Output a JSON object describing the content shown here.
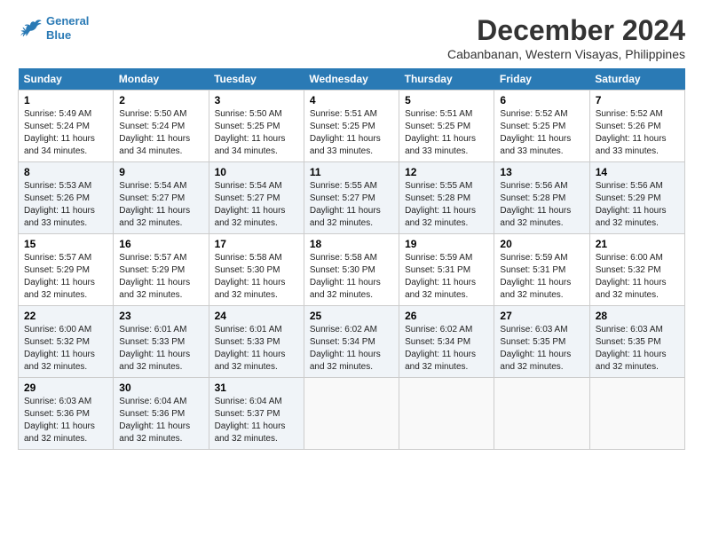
{
  "logo": {
    "line1": "General",
    "line2": "Blue"
  },
  "title": "December 2024",
  "location": "Cabanbanan, Western Visayas, Philippines",
  "days_of_week": [
    "Sunday",
    "Monday",
    "Tuesday",
    "Wednesday",
    "Thursday",
    "Friday",
    "Saturday"
  ],
  "weeks": [
    [
      {
        "day": 1,
        "sunrise": "5:49 AM",
        "sunset": "5:24 PM",
        "daylight": "11 hours and 34 minutes."
      },
      {
        "day": 2,
        "sunrise": "5:50 AM",
        "sunset": "5:24 PM",
        "daylight": "11 hours and 34 minutes."
      },
      {
        "day": 3,
        "sunrise": "5:50 AM",
        "sunset": "5:25 PM",
        "daylight": "11 hours and 34 minutes."
      },
      {
        "day": 4,
        "sunrise": "5:51 AM",
        "sunset": "5:25 PM",
        "daylight": "11 hours and 33 minutes."
      },
      {
        "day": 5,
        "sunrise": "5:51 AM",
        "sunset": "5:25 PM",
        "daylight": "11 hours and 33 minutes."
      },
      {
        "day": 6,
        "sunrise": "5:52 AM",
        "sunset": "5:25 PM",
        "daylight": "11 hours and 33 minutes."
      },
      {
        "day": 7,
        "sunrise": "5:52 AM",
        "sunset": "5:26 PM",
        "daylight": "11 hours and 33 minutes."
      }
    ],
    [
      {
        "day": 8,
        "sunrise": "5:53 AM",
        "sunset": "5:26 PM",
        "daylight": "11 hours and 33 minutes."
      },
      {
        "day": 9,
        "sunrise": "5:54 AM",
        "sunset": "5:27 PM",
        "daylight": "11 hours and 32 minutes."
      },
      {
        "day": 10,
        "sunrise": "5:54 AM",
        "sunset": "5:27 PM",
        "daylight": "11 hours and 32 minutes."
      },
      {
        "day": 11,
        "sunrise": "5:55 AM",
        "sunset": "5:27 PM",
        "daylight": "11 hours and 32 minutes."
      },
      {
        "day": 12,
        "sunrise": "5:55 AM",
        "sunset": "5:28 PM",
        "daylight": "11 hours and 32 minutes."
      },
      {
        "day": 13,
        "sunrise": "5:56 AM",
        "sunset": "5:28 PM",
        "daylight": "11 hours and 32 minutes."
      },
      {
        "day": 14,
        "sunrise": "5:56 AM",
        "sunset": "5:29 PM",
        "daylight": "11 hours and 32 minutes."
      }
    ],
    [
      {
        "day": 15,
        "sunrise": "5:57 AM",
        "sunset": "5:29 PM",
        "daylight": "11 hours and 32 minutes."
      },
      {
        "day": 16,
        "sunrise": "5:57 AM",
        "sunset": "5:29 PM",
        "daylight": "11 hours and 32 minutes."
      },
      {
        "day": 17,
        "sunrise": "5:58 AM",
        "sunset": "5:30 PM",
        "daylight": "11 hours and 32 minutes."
      },
      {
        "day": 18,
        "sunrise": "5:58 AM",
        "sunset": "5:30 PM",
        "daylight": "11 hours and 32 minutes."
      },
      {
        "day": 19,
        "sunrise": "5:59 AM",
        "sunset": "5:31 PM",
        "daylight": "11 hours and 32 minutes."
      },
      {
        "day": 20,
        "sunrise": "5:59 AM",
        "sunset": "5:31 PM",
        "daylight": "11 hours and 32 minutes."
      },
      {
        "day": 21,
        "sunrise": "6:00 AM",
        "sunset": "5:32 PM",
        "daylight": "11 hours and 32 minutes."
      }
    ],
    [
      {
        "day": 22,
        "sunrise": "6:00 AM",
        "sunset": "5:32 PM",
        "daylight": "11 hours and 32 minutes."
      },
      {
        "day": 23,
        "sunrise": "6:01 AM",
        "sunset": "5:33 PM",
        "daylight": "11 hours and 32 minutes."
      },
      {
        "day": 24,
        "sunrise": "6:01 AM",
        "sunset": "5:33 PM",
        "daylight": "11 hours and 32 minutes."
      },
      {
        "day": 25,
        "sunrise": "6:02 AM",
        "sunset": "5:34 PM",
        "daylight": "11 hours and 32 minutes."
      },
      {
        "day": 26,
        "sunrise": "6:02 AM",
        "sunset": "5:34 PM",
        "daylight": "11 hours and 32 minutes."
      },
      {
        "day": 27,
        "sunrise": "6:03 AM",
        "sunset": "5:35 PM",
        "daylight": "11 hours and 32 minutes."
      },
      {
        "day": 28,
        "sunrise": "6:03 AM",
        "sunset": "5:35 PM",
        "daylight": "11 hours and 32 minutes."
      }
    ],
    [
      {
        "day": 29,
        "sunrise": "6:03 AM",
        "sunset": "5:36 PM",
        "daylight": "11 hours and 32 minutes."
      },
      {
        "day": 30,
        "sunrise": "6:04 AM",
        "sunset": "5:36 PM",
        "daylight": "11 hours and 32 minutes."
      },
      {
        "day": 31,
        "sunrise": "6:04 AM",
        "sunset": "5:37 PM",
        "daylight": "11 hours and 32 minutes."
      },
      null,
      null,
      null,
      null
    ]
  ],
  "labels": {
    "sunrise": "Sunrise:",
    "sunset": "Sunset:",
    "daylight": "Daylight:"
  }
}
